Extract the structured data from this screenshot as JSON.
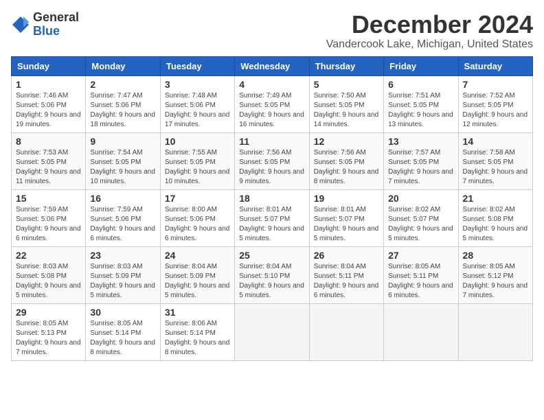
{
  "logo": {
    "general": "General",
    "blue": "Blue"
  },
  "title": "December 2024",
  "location": "Vandercook Lake, Michigan, United States",
  "headers": [
    "Sunday",
    "Monday",
    "Tuesday",
    "Wednesday",
    "Thursday",
    "Friday",
    "Saturday"
  ],
  "weeks": [
    [
      {
        "day": "1",
        "sunrise": "Sunrise: 7:46 AM",
        "sunset": "Sunset: 5:06 PM",
        "daylight": "Daylight: 9 hours and 19 minutes."
      },
      {
        "day": "2",
        "sunrise": "Sunrise: 7:47 AM",
        "sunset": "Sunset: 5:06 PM",
        "daylight": "Daylight: 9 hours and 18 minutes."
      },
      {
        "day": "3",
        "sunrise": "Sunrise: 7:48 AM",
        "sunset": "Sunset: 5:06 PM",
        "daylight": "Daylight: 9 hours and 17 minutes."
      },
      {
        "day": "4",
        "sunrise": "Sunrise: 7:49 AM",
        "sunset": "Sunset: 5:05 PM",
        "daylight": "Daylight: 9 hours and 16 minutes."
      },
      {
        "day": "5",
        "sunrise": "Sunrise: 7:50 AM",
        "sunset": "Sunset: 5:05 PM",
        "daylight": "Daylight: 9 hours and 14 minutes."
      },
      {
        "day": "6",
        "sunrise": "Sunrise: 7:51 AM",
        "sunset": "Sunset: 5:05 PM",
        "daylight": "Daylight: 9 hours and 13 minutes."
      },
      {
        "day": "7",
        "sunrise": "Sunrise: 7:52 AM",
        "sunset": "Sunset: 5:05 PM",
        "daylight": "Daylight: 9 hours and 12 minutes."
      }
    ],
    [
      {
        "day": "8",
        "sunrise": "Sunrise: 7:53 AM",
        "sunset": "Sunset: 5:05 PM",
        "daylight": "Daylight: 9 hours and 11 minutes."
      },
      {
        "day": "9",
        "sunrise": "Sunrise: 7:54 AM",
        "sunset": "Sunset: 5:05 PM",
        "daylight": "Daylight: 9 hours and 10 minutes."
      },
      {
        "day": "10",
        "sunrise": "Sunrise: 7:55 AM",
        "sunset": "Sunset: 5:05 PM",
        "daylight": "Daylight: 9 hours and 10 minutes."
      },
      {
        "day": "11",
        "sunrise": "Sunrise: 7:56 AM",
        "sunset": "Sunset: 5:05 PM",
        "daylight": "Daylight: 9 hours and 9 minutes."
      },
      {
        "day": "12",
        "sunrise": "Sunrise: 7:56 AM",
        "sunset": "Sunset: 5:05 PM",
        "daylight": "Daylight: 9 hours and 8 minutes."
      },
      {
        "day": "13",
        "sunrise": "Sunrise: 7:57 AM",
        "sunset": "Sunset: 5:05 PM",
        "daylight": "Daylight: 9 hours and 7 minutes."
      },
      {
        "day": "14",
        "sunrise": "Sunrise: 7:58 AM",
        "sunset": "Sunset: 5:05 PM",
        "daylight": "Daylight: 9 hours and 7 minutes."
      }
    ],
    [
      {
        "day": "15",
        "sunrise": "Sunrise: 7:59 AM",
        "sunset": "Sunset: 5:06 PM",
        "daylight": "Daylight: 9 hours and 6 minutes."
      },
      {
        "day": "16",
        "sunrise": "Sunrise: 7:59 AM",
        "sunset": "Sunset: 5:06 PM",
        "daylight": "Daylight: 9 hours and 6 minutes."
      },
      {
        "day": "17",
        "sunrise": "Sunrise: 8:00 AM",
        "sunset": "Sunset: 5:06 PM",
        "daylight": "Daylight: 9 hours and 6 minutes."
      },
      {
        "day": "18",
        "sunrise": "Sunrise: 8:01 AM",
        "sunset": "Sunset: 5:07 PM",
        "daylight": "Daylight: 9 hours and 5 minutes."
      },
      {
        "day": "19",
        "sunrise": "Sunrise: 8:01 AM",
        "sunset": "Sunset: 5:07 PM",
        "daylight": "Daylight: 9 hours and 5 minutes."
      },
      {
        "day": "20",
        "sunrise": "Sunrise: 8:02 AM",
        "sunset": "Sunset: 5:07 PM",
        "daylight": "Daylight: 9 hours and 5 minutes."
      },
      {
        "day": "21",
        "sunrise": "Sunrise: 8:02 AM",
        "sunset": "Sunset: 5:08 PM",
        "daylight": "Daylight: 9 hours and 5 minutes."
      }
    ],
    [
      {
        "day": "22",
        "sunrise": "Sunrise: 8:03 AM",
        "sunset": "Sunset: 5:08 PM",
        "daylight": "Daylight: 9 hours and 5 minutes."
      },
      {
        "day": "23",
        "sunrise": "Sunrise: 8:03 AM",
        "sunset": "Sunset: 5:09 PM",
        "daylight": "Daylight: 9 hours and 5 minutes."
      },
      {
        "day": "24",
        "sunrise": "Sunrise: 8:04 AM",
        "sunset": "Sunset: 5:09 PM",
        "daylight": "Daylight: 9 hours and 5 minutes."
      },
      {
        "day": "25",
        "sunrise": "Sunrise: 8:04 AM",
        "sunset": "Sunset: 5:10 PM",
        "daylight": "Daylight: 9 hours and 5 minutes."
      },
      {
        "day": "26",
        "sunrise": "Sunrise: 8:04 AM",
        "sunset": "Sunset: 5:11 PM",
        "daylight": "Daylight: 9 hours and 6 minutes."
      },
      {
        "day": "27",
        "sunrise": "Sunrise: 8:05 AM",
        "sunset": "Sunset: 5:11 PM",
        "daylight": "Daylight: 9 hours and 6 minutes."
      },
      {
        "day": "28",
        "sunrise": "Sunrise: 8:05 AM",
        "sunset": "Sunset: 5:12 PM",
        "daylight": "Daylight: 9 hours and 7 minutes."
      }
    ],
    [
      {
        "day": "29",
        "sunrise": "Sunrise: 8:05 AM",
        "sunset": "Sunset: 5:13 PM",
        "daylight": "Daylight: 9 hours and 7 minutes."
      },
      {
        "day": "30",
        "sunrise": "Sunrise: 8:05 AM",
        "sunset": "Sunset: 5:14 PM",
        "daylight": "Daylight: 9 hours and 8 minutes."
      },
      {
        "day": "31",
        "sunrise": "Sunrise: 8:06 AM",
        "sunset": "Sunset: 5:14 PM",
        "daylight": "Daylight: 9 hours and 8 minutes."
      },
      null,
      null,
      null,
      null
    ]
  ]
}
